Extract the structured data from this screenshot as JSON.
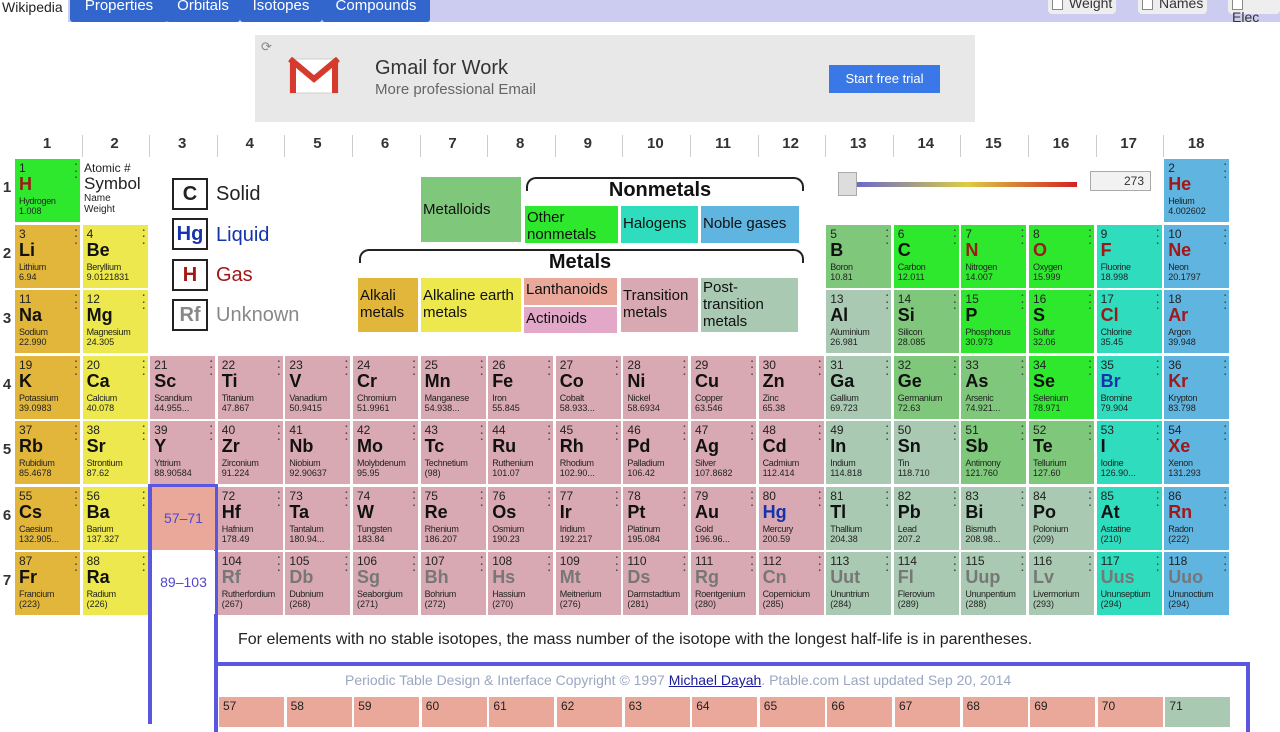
{
  "topbar": {
    "wiki": "Wikipedia",
    "tabs": [
      "Properties",
      "Orbitals",
      "Isotopes",
      "Compounds"
    ],
    "options": [
      "Weight",
      "Names",
      "Elec"
    ]
  },
  "ad": {
    "refresh_icon": "refresh-icon",
    "title": "Gmail for Work",
    "subtitle": "More professional Email",
    "cta": "Start free trial"
  },
  "groups": [
    "1",
    "2",
    "3",
    "4",
    "5",
    "6",
    "7",
    "8",
    "9",
    "10",
    "11",
    "12",
    "13",
    "14",
    "15",
    "16",
    "17",
    "18"
  ],
  "periods": [
    "1",
    "2",
    "3",
    "4",
    "5",
    "6",
    "7"
  ],
  "key": {
    "atomic": "Atomic #",
    "symbol": "Symbol",
    "name": "Name",
    "weight": "Weight"
  },
  "legend": [
    {
      "sym": "C",
      "label": "Solid",
      "color": "#222222"
    },
    {
      "sym": "Hg",
      "label": "Liquid",
      "color": "#1533aa"
    },
    {
      "sym": "H",
      "label": "Gas",
      "color": "#a01818"
    },
    {
      "sym": "Rf",
      "label": "Unknown",
      "color": "#888888"
    }
  ],
  "categories": {
    "nonmetals_title": "Nonmetals",
    "metals_title": "Metals",
    "metalloids": "Metalloids",
    "other_nonmetals": "Other nonmetals",
    "halogens": "Halogens",
    "noble_gases": "Noble gases",
    "alkali": "Alkali metals",
    "alkaline": "Alkaline earth metals",
    "lanthanoids": "Lanthanoids",
    "actinoids": "Actinoids",
    "transition": "Transition metals",
    "post_transition": "Post-transition metals"
  },
  "temperature": {
    "value": "273"
  },
  "refs": {
    "lan": "57–71",
    "act": "89–103"
  },
  "note": "For elements with no stable isotopes, the mass number of the isotope with the longest half-life is in parentheses.",
  "credit": {
    "prefix": "Periodic Table Design & Interface Copyright © 1997 ",
    "author": "Michael Dayah",
    "suffix": ". Ptable.com Last updated Sep 20, 2014"
  },
  "elements": [
    {
      "n": "1",
      "s": "H",
      "name": "Hydrogen",
      "w": "1.008",
      "c": "onm",
      "st": "gas",
      "col": 1,
      "row": 1
    },
    {
      "n": "2",
      "s": "He",
      "name": "Helium",
      "w": "4.002602",
      "c": "nob",
      "st": "gas",
      "col": 18,
      "row": 1
    },
    {
      "n": "3",
      "s": "Li",
      "name": "Lithium",
      "w": "6.94",
      "c": "alk",
      "st": "solid",
      "col": 1,
      "row": 2
    },
    {
      "n": "4",
      "s": "Be",
      "name": "Beryllium",
      "w": "9.0121831",
      "c": "ae",
      "st": "solid",
      "col": 2,
      "row": 2
    },
    {
      "n": "5",
      "s": "B",
      "name": "Boron",
      "w": "10.81",
      "c": "met",
      "st": "solid",
      "col": 13,
      "row": 2
    },
    {
      "n": "6",
      "s": "C",
      "name": "Carbon",
      "w": "12.011",
      "c": "onm",
      "st": "solid",
      "col": 14,
      "row": 2
    },
    {
      "n": "7",
      "s": "N",
      "name": "Nitrogen",
      "w": "14.007",
      "c": "onm",
      "st": "gas",
      "col": 15,
      "row": 2
    },
    {
      "n": "8",
      "s": "O",
      "name": "Oxygen",
      "w": "15.999",
      "c": "onm",
      "st": "gas",
      "col": 16,
      "row": 2
    },
    {
      "n": "9",
      "s": "F",
      "name": "Fluorine",
      "w": "18.998",
      "c": "hal",
      "st": "gas",
      "col": 17,
      "row": 2
    },
    {
      "n": "10",
      "s": "Ne",
      "name": "Neon",
      "w": "20.1797",
      "c": "nob",
      "st": "gas",
      "col": 18,
      "row": 2
    },
    {
      "n": "11",
      "s": "Na",
      "name": "Sodium",
      "w": "22.990",
      "c": "alk",
      "st": "solid",
      "col": 1,
      "row": 3
    },
    {
      "n": "12",
      "s": "Mg",
      "name": "Magnesium",
      "w": "24.305",
      "c": "ae",
      "st": "solid",
      "col": 2,
      "row": 3
    },
    {
      "n": "13",
      "s": "Al",
      "name": "Aluminium",
      "w": "26.981",
      "c": "pt",
      "st": "solid",
      "col": 13,
      "row": 3
    },
    {
      "n": "14",
      "s": "Si",
      "name": "Silicon",
      "w": "28.085",
      "c": "met",
      "st": "solid",
      "col": 14,
      "row": 3
    },
    {
      "n": "15",
      "s": "P",
      "name": "Phosphorus",
      "w": "30.973",
      "c": "onm",
      "st": "solid",
      "col": 15,
      "row": 3
    },
    {
      "n": "16",
      "s": "S",
      "name": "Sulfur",
      "w": "32.06",
      "c": "onm",
      "st": "solid",
      "col": 16,
      "row": 3
    },
    {
      "n": "17",
      "s": "Cl",
      "name": "Chlorine",
      "w": "35.45",
      "c": "hal",
      "st": "gas",
      "col": 17,
      "row": 3
    },
    {
      "n": "18",
      "s": "Ar",
      "name": "Argon",
      "w": "39.948",
      "c": "nob",
      "st": "gas",
      "col": 18,
      "row": 3
    },
    {
      "n": "19",
      "s": "K",
      "name": "Potassium",
      "w": "39.0983",
      "c": "alk",
      "st": "solid",
      "col": 1,
      "row": 4
    },
    {
      "n": "20",
      "s": "Ca",
      "name": "Calcium",
      "w": "40.078",
      "c": "ae",
      "st": "solid",
      "col": 2,
      "row": 4
    },
    {
      "n": "21",
      "s": "Sc",
      "name": "Scandium",
      "w": "44.955...",
      "c": "tr",
      "st": "solid",
      "col": 3,
      "row": 4
    },
    {
      "n": "22",
      "s": "Ti",
      "name": "Titanium",
      "w": "47.867",
      "c": "tr",
      "st": "solid",
      "col": 4,
      "row": 4
    },
    {
      "n": "23",
      "s": "V",
      "name": "Vanadium",
      "w": "50.9415",
      "c": "tr",
      "st": "solid",
      "col": 5,
      "row": 4
    },
    {
      "n": "24",
      "s": "Cr",
      "name": "Chromium",
      "w": "51.9961",
      "c": "tr",
      "st": "solid",
      "col": 6,
      "row": 4
    },
    {
      "n": "25",
      "s": "Mn",
      "name": "Manganese",
      "w": "54.938...",
      "c": "tr",
      "st": "solid",
      "col": 7,
      "row": 4
    },
    {
      "n": "26",
      "s": "Fe",
      "name": "Iron",
      "w": "55.845",
      "c": "tr",
      "st": "solid",
      "col": 8,
      "row": 4
    },
    {
      "n": "27",
      "s": "Co",
      "name": "Cobalt",
      "w": "58.933...",
      "c": "tr",
      "st": "solid",
      "col": 9,
      "row": 4
    },
    {
      "n": "28",
      "s": "Ni",
      "name": "Nickel",
      "w": "58.6934",
      "c": "tr",
      "st": "solid",
      "col": 10,
      "row": 4
    },
    {
      "n": "29",
      "s": "Cu",
      "name": "Copper",
      "w": "63.546",
      "c": "tr",
      "st": "solid",
      "col": 11,
      "row": 4
    },
    {
      "n": "30",
      "s": "Zn",
      "name": "Zinc",
      "w": "65.38",
      "c": "tr",
      "st": "solid",
      "col": 12,
      "row": 4
    },
    {
      "n": "31",
      "s": "Ga",
      "name": "Gallium",
      "w": "69.723",
      "c": "pt",
      "st": "solid",
      "col": 13,
      "row": 4
    },
    {
      "n": "32",
      "s": "Ge",
      "name": "Germanium",
      "w": "72.63",
      "c": "met",
      "st": "solid",
      "col": 14,
      "row": 4
    },
    {
      "n": "33",
      "s": "As",
      "name": "Arsenic",
      "w": "74.921...",
      "c": "met",
      "st": "solid",
      "col": 15,
      "row": 4
    },
    {
      "n": "34",
      "s": "Se",
      "name": "Selenium",
      "w": "78.971",
      "c": "onm",
      "st": "solid",
      "col": 16,
      "row": 4
    },
    {
      "n": "35",
      "s": "Br",
      "name": "Bromine",
      "w": "79.904",
      "c": "hal",
      "st": "liquid",
      "col": 17,
      "row": 4
    },
    {
      "n": "36",
      "s": "Kr",
      "name": "Krypton",
      "w": "83.798",
      "c": "nob",
      "st": "gas",
      "col": 18,
      "row": 4
    },
    {
      "n": "37",
      "s": "Rb",
      "name": "Rubidium",
      "w": "85.4678",
      "c": "alk",
      "st": "solid",
      "col": 1,
      "row": 5
    },
    {
      "n": "38",
      "s": "Sr",
      "name": "Strontium",
      "w": "87.62",
      "c": "ae",
      "st": "solid",
      "col": 2,
      "row": 5
    },
    {
      "n": "39",
      "s": "Y",
      "name": "Yttrium",
      "w": "88.90584",
      "c": "tr",
      "st": "solid",
      "col": 3,
      "row": 5
    },
    {
      "n": "40",
      "s": "Zr",
      "name": "Zirconium",
      "w": "91.224",
      "c": "tr",
      "st": "solid",
      "col": 4,
      "row": 5
    },
    {
      "n": "41",
      "s": "Nb",
      "name": "Niobium",
      "w": "92.90637",
      "c": "tr",
      "st": "solid",
      "col": 5,
      "row": 5
    },
    {
      "n": "42",
      "s": "Mo",
      "name": "Molybdenum",
      "w": "95.95",
      "c": "tr",
      "st": "solid",
      "col": 6,
      "row": 5
    },
    {
      "n": "43",
      "s": "Tc",
      "name": "Technetium",
      "w": "(98)",
      "c": "tr",
      "st": "solid",
      "col": 7,
      "row": 5
    },
    {
      "n": "44",
      "s": "Ru",
      "name": "Ruthenium",
      "w": "101.07",
      "c": "tr",
      "st": "solid",
      "col": 8,
      "row": 5
    },
    {
      "n": "45",
      "s": "Rh",
      "name": "Rhodium",
      "w": "102.90...",
      "c": "tr",
      "st": "solid",
      "col": 9,
      "row": 5
    },
    {
      "n": "46",
      "s": "Pd",
      "name": "Palladium",
      "w": "106.42",
      "c": "tr",
      "st": "solid",
      "col": 10,
      "row": 5
    },
    {
      "n": "47",
      "s": "Ag",
      "name": "Silver",
      "w": "107.8682",
      "c": "tr",
      "st": "solid",
      "col": 11,
      "row": 5
    },
    {
      "n": "48",
      "s": "Cd",
      "name": "Cadmium",
      "w": "112.414",
      "c": "tr",
      "st": "solid",
      "col": 12,
      "row": 5
    },
    {
      "n": "49",
      "s": "In",
      "name": "Indium",
      "w": "114.818",
      "c": "pt",
      "st": "solid",
      "col": 13,
      "row": 5
    },
    {
      "n": "50",
      "s": "Sn",
      "name": "Tin",
      "w": "118.710",
      "c": "pt",
      "st": "solid",
      "col": 14,
      "row": 5
    },
    {
      "n": "51",
      "s": "Sb",
      "name": "Antimony",
      "w": "121.760",
      "c": "met",
      "st": "solid",
      "col": 15,
      "row": 5
    },
    {
      "n": "52",
      "s": "Te",
      "name": "Tellurium",
      "w": "127.60",
      "c": "met",
      "st": "solid",
      "col": 16,
      "row": 5
    },
    {
      "n": "53",
      "s": "I",
      "name": "Iodine",
      "w": "126.90...",
      "c": "hal",
      "st": "solid",
      "col": 17,
      "row": 5
    },
    {
      "n": "54",
      "s": "Xe",
      "name": "Xenon",
      "w": "131.293",
      "c": "nob",
      "st": "gas",
      "col": 18,
      "row": 5
    },
    {
      "n": "55",
      "s": "Cs",
      "name": "Caesium",
      "w": "132.905...",
      "c": "alk",
      "st": "solid",
      "col": 1,
      "row": 6
    },
    {
      "n": "56",
      "s": "Ba",
      "name": "Barium",
      "w": "137.327",
      "c": "ae",
      "st": "solid",
      "col": 2,
      "row": 6
    },
    {
      "n": "72",
      "s": "Hf",
      "name": "Hafnium",
      "w": "178.49",
      "c": "tr",
      "st": "solid",
      "col": 4,
      "row": 6
    },
    {
      "n": "73",
      "s": "Ta",
      "name": "Tantalum",
      "w": "180.94...",
      "c": "tr",
      "st": "solid",
      "col": 5,
      "row": 6
    },
    {
      "n": "74",
      "s": "W",
      "name": "Tungsten",
      "w": "183.84",
      "c": "tr",
      "st": "solid",
      "col": 6,
      "row": 6
    },
    {
      "n": "75",
      "s": "Re",
      "name": "Rhenium",
      "w": "186.207",
      "c": "tr",
      "st": "solid",
      "col": 7,
      "row": 6
    },
    {
      "n": "76",
      "s": "Os",
      "name": "Osmium",
      "w": "190.23",
      "c": "tr",
      "st": "solid",
      "col": 8,
      "row": 6
    },
    {
      "n": "77",
      "s": "Ir",
      "name": "Iridium",
      "w": "192.217",
      "c": "tr",
      "st": "solid",
      "col": 9,
      "row": 6
    },
    {
      "n": "78",
      "s": "Pt",
      "name": "Platinum",
      "w": "195.084",
      "c": "tr",
      "st": "solid",
      "col": 10,
      "row": 6
    },
    {
      "n": "79",
      "s": "Au",
      "name": "Gold",
      "w": "196.96...",
      "c": "tr",
      "st": "solid",
      "col": 11,
      "row": 6
    },
    {
      "n": "80",
      "s": "Hg",
      "name": "Mercury",
      "w": "200.59",
      "c": "tr",
      "st": "liquid",
      "col": 12,
      "row": 6
    },
    {
      "n": "81",
      "s": "Tl",
      "name": "Thallium",
      "w": "204.38",
      "c": "pt",
      "st": "solid",
      "col": 13,
      "row": 6
    },
    {
      "n": "82",
      "s": "Pb",
      "name": "Lead",
      "w": "207.2",
      "c": "pt",
      "st": "solid",
      "col": 14,
      "row": 6
    },
    {
      "n": "83",
      "s": "Bi",
      "name": "Bismuth",
      "w": "208.98...",
      "c": "pt",
      "st": "solid",
      "col": 15,
      "row": 6
    },
    {
      "n": "84",
      "s": "Po",
      "name": "Polonium",
      "w": "(209)",
      "c": "pt",
      "st": "solid",
      "col": 16,
      "row": 6
    },
    {
      "n": "85",
      "s": "At",
      "name": "Astatine",
      "w": "(210)",
      "c": "hal",
      "st": "solid",
      "col": 17,
      "row": 6
    },
    {
      "n": "86",
      "s": "Rn",
      "name": "Radon",
      "w": "(222)",
      "c": "nob",
      "st": "gas",
      "col": 18,
      "row": 6
    },
    {
      "n": "87",
      "s": "Fr",
      "name": "Francium",
      "w": "(223)",
      "c": "alk",
      "st": "solid",
      "col": 1,
      "row": 7
    },
    {
      "n": "88",
      "s": "Ra",
      "name": "Radium",
      "w": "(226)",
      "c": "ae",
      "st": "solid",
      "col": 2,
      "row": 7
    },
    {
      "n": "104",
      "s": "Rf",
      "name": "Rutherfordium",
      "w": "(267)",
      "c": "tr",
      "st": "unknown",
      "col": 4,
      "row": 7
    },
    {
      "n": "105",
      "s": "Db",
      "name": "Dubnium",
      "w": "(268)",
      "c": "tr",
      "st": "unknown",
      "col": 5,
      "row": 7
    },
    {
      "n": "106",
      "s": "Sg",
      "name": "Seaborgium",
      "w": "(271)",
      "c": "tr",
      "st": "unknown",
      "col": 6,
      "row": 7
    },
    {
      "n": "107",
      "s": "Bh",
      "name": "Bohrium",
      "w": "(272)",
      "c": "tr",
      "st": "unknown",
      "col": 7,
      "row": 7
    },
    {
      "n": "108",
      "s": "Hs",
      "name": "Hassium",
      "w": "(270)",
      "c": "tr",
      "st": "unknown",
      "col": 8,
      "row": 7
    },
    {
      "n": "109",
      "s": "Mt",
      "name": "Meitnerium",
      "w": "(276)",
      "c": "tr",
      "st": "unknown",
      "col": 9,
      "row": 7
    },
    {
      "n": "110",
      "s": "Ds",
      "name": "Darmstadtium",
      "w": "(281)",
      "c": "tr",
      "st": "unknown",
      "col": 10,
      "row": 7
    },
    {
      "n": "111",
      "s": "Rg",
      "name": "Roentgenium",
      "w": "(280)",
      "c": "tr",
      "st": "unknown",
      "col": 11,
      "row": 7
    },
    {
      "n": "112",
      "s": "Cn",
      "name": "Copernicium",
      "w": "(285)",
      "c": "tr",
      "st": "unknown",
      "col": 12,
      "row": 7
    },
    {
      "n": "113",
      "s": "Uut",
      "name": "Ununtrium",
      "w": "(284)",
      "c": "pt",
      "st": "unknown",
      "col": 13,
      "row": 7
    },
    {
      "n": "114",
      "s": "Fl",
      "name": "Flerovium",
      "w": "(289)",
      "c": "pt",
      "st": "unknown",
      "col": 14,
      "row": 7
    },
    {
      "n": "115",
      "s": "Uup",
      "name": "Ununpentium",
      "w": "(288)",
      "c": "pt",
      "st": "unknown",
      "col": 15,
      "row": 7
    },
    {
      "n": "116",
      "s": "Lv",
      "name": "Livermorium",
      "w": "(293)",
      "c": "pt",
      "st": "unknown",
      "col": 16,
      "row": 7
    },
    {
      "n": "117",
      "s": "Uus",
      "name": "Ununseptium",
      "w": "(294)",
      "c": "hal",
      "st": "unknown",
      "col": 17,
      "row": 7
    },
    {
      "n": "118",
      "s": "Uuo",
      "name": "Ununoctium",
      "w": "(294)",
      "c": "nob",
      "st": "unknown",
      "col": 18,
      "row": 7
    }
  ],
  "fblock_numbers": [
    "57",
    "58",
    "59",
    "60",
    "61",
    "62",
    "63",
    "64",
    "65",
    "66",
    "67",
    "68",
    "69",
    "70",
    "71"
  ]
}
